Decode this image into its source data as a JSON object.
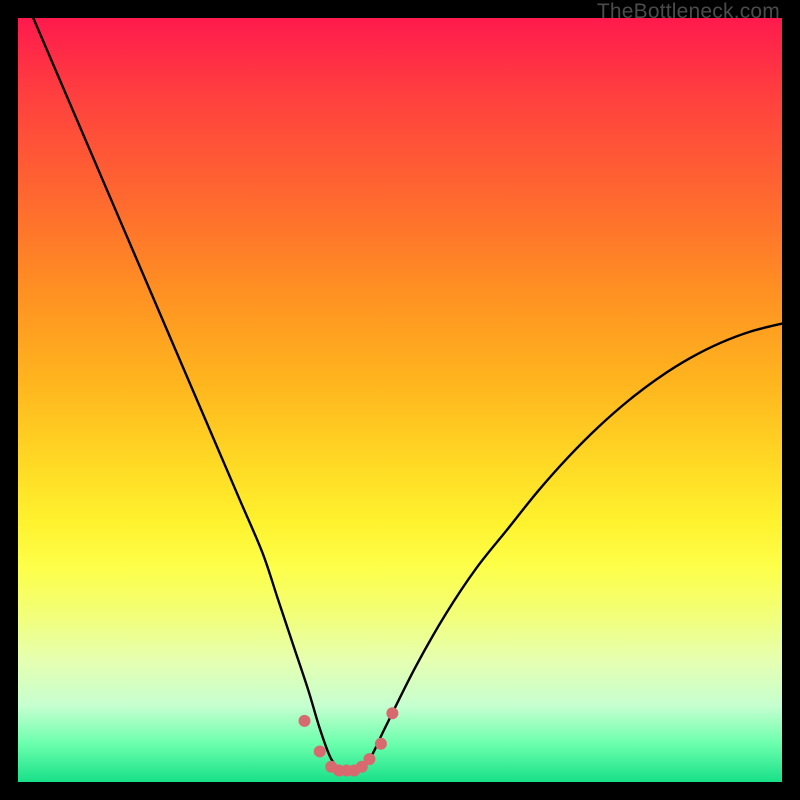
{
  "watermark": "TheBottleneck.com",
  "chart_data": {
    "type": "line",
    "title": "",
    "xlabel": "",
    "ylabel": "",
    "xlim": [
      0,
      100
    ],
    "ylim": [
      0,
      100
    ],
    "grid": false,
    "series": [
      {
        "name": "bottleneck-curve",
        "color": "#000000",
        "x": [
          2,
          5,
          8,
          11,
          14,
          17,
          20,
          23,
          26,
          29,
          32,
          34,
          36,
          38,
          39.5,
          41,
          42.5,
          44,
          46,
          48,
          52,
          56,
          60,
          64,
          68,
          72,
          76,
          80,
          84,
          88,
          92,
          96,
          100
        ],
        "y": [
          100,
          93,
          86,
          79,
          72,
          65,
          58,
          51,
          44,
          37,
          30,
          24,
          18,
          12,
          7,
          3,
          1.5,
          1.5,
          3,
          7,
          15,
          22,
          28,
          33,
          38,
          42.5,
          46.5,
          50,
          53,
          55.5,
          57.5,
          59,
          60
        ]
      },
      {
        "name": "valley-markers",
        "color": "#d86a6f",
        "type": "scatter",
        "x": [
          37.5,
          39.5,
          41,
          42,
          43,
          44,
          45,
          46,
          47.5,
          49
        ],
        "y": [
          8,
          4,
          2,
          1.5,
          1.5,
          1.5,
          2,
          3,
          5,
          9
        ],
        "marker_radius_px": 6
      }
    ]
  }
}
